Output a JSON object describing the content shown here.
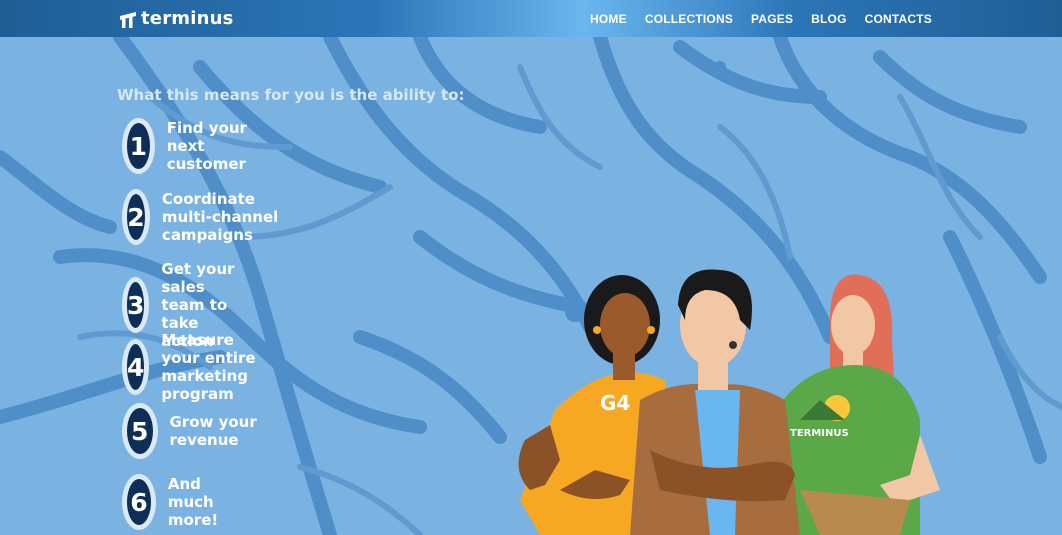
{
  "brand": {
    "name": "terminus"
  },
  "nav": {
    "items": [
      "HOME",
      "COLLECTIONS",
      "PAGES",
      "BLOG",
      "CONTACTS"
    ]
  },
  "hero": {
    "intro": "What this means for you is the ability to:",
    "steps": [
      {
        "number": "1",
        "text": "Find your next customer"
      },
      {
        "number": "2",
        "text": "Coordinate multi-channel campaigns"
      },
      {
        "number": "3",
        "text": "Get your sales team to take action"
      },
      {
        "number": "4",
        "text": "Measure your entire marketing program"
      },
      {
        "number": "5",
        "text": "Grow your revenue"
      },
      {
        "number": "6",
        "text": "And much more!"
      }
    ]
  },
  "illustration": {
    "shirt_left_text": "G4",
    "shirt_right_text": "TERMINUS"
  },
  "colors": {
    "background": "#7ab2e2",
    "nav_dark": "#1f5e95",
    "nav_light": "#6ab6ee",
    "badge": "#0f2e57",
    "badge_ring": "#d9e9f6"
  }
}
